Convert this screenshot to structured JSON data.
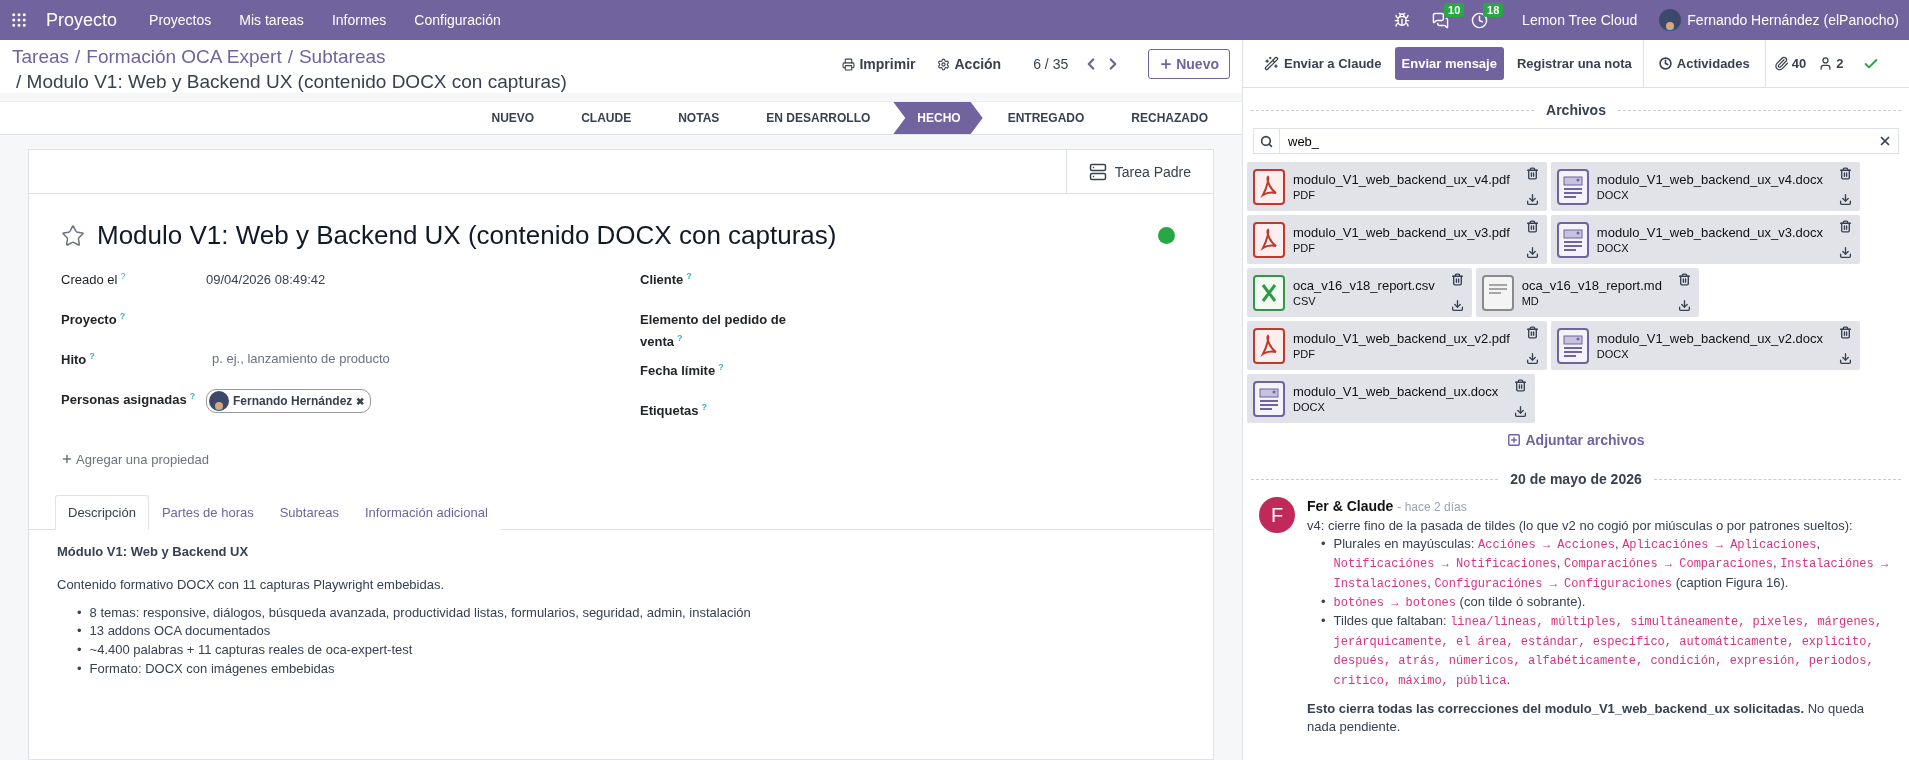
{
  "navbar": {
    "app": "Proyecto",
    "menus": [
      "Proyectos",
      "Mis tareas",
      "Informes",
      "Configuración"
    ],
    "messages_count": "10",
    "activities_count": "18",
    "company": "Lemon Tree Cloud",
    "user": "Fernando Hernández (elPanocho)"
  },
  "breadcrumb": {
    "separator": "/",
    "parents": [
      "Tareas",
      "Formación OCA Expert",
      "Subtareas"
    ],
    "current": "/ Modulo V1: Web y Backend UX (contenido DOCX con capturas)"
  },
  "actions": {
    "print": "Imprimir",
    "action": "Acción",
    "pager": "6 / 35",
    "new": "Nuevo"
  },
  "stages": [
    {
      "label": "NUEVO",
      "selected": false
    },
    {
      "label": "CLAUDE",
      "selected": false
    },
    {
      "label": "NOTAS",
      "selected": false
    },
    {
      "label": "EN DESARROLLO",
      "selected": false
    },
    {
      "label": "HECHO",
      "selected": true
    },
    {
      "label": "ENTREGADO",
      "selected": false
    },
    {
      "label": "RECHAZADO",
      "selected": false
    }
  ],
  "form": {
    "parent_button": "Tarea Padre",
    "starred": false,
    "title": "Modulo V1: Web y Backend UX (contenido DOCX con capturas)",
    "status_done": true,
    "left_fields": [
      {
        "label": "Creado el",
        "help": "?",
        "kind": "value",
        "value": "09/04/2026 08:49:42"
      },
      {
        "label": "Proyecto",
        "help": "?"
      },
      {
        "label": "Hito",
        "help": "?",
        "kind": "placeholder",
        "placeholder": "p. ej., lanzamiento de producto"
      },
      {
        "label": "Personas asignadas",
        "help": "?",
        "kind": "tag",
        "value": "Fernando Hernández",
        "remove": "✖"
      }
    ],
    "right_fields": [
      {
        "label": "Cliente",
        "help": "?"
      },
      {
        "label": "Elemento del pedido de venta",
        "help": "?"
      },
      {
        "label": "Fecha límite",
        "help": "?"
      },
      {
        "label": "Etiquetas",
        "help": "?"
      }
    ],
    "add_property": "Agregar una propiedad",
    "tabs": [
      {
        "label": "Descripción",
        "selected": true
      },
      {
        "label": "Partes de horas",
        "selected": false
      },
      {
        "label": "Subtareas",
        "selected": false
      },
      {
        "label": "Información adicional",
        "selected": false
      }
    ],
    "description": {
      "heading": "Módulo V1: Web y Backend UX",
      "paragraph": "Contenido formativo DOCX con 11 capturas Playwright embebidas.",
      "marker": "•",
      "bullets": [
        "8 temas: responsive, diálogos, búsqueda avanzada, productividad listas, formularios, seguridad, admin, instalación",
        "13 addons OCA documentados",
        "~4.400 palabras + 11 capturas reales de oca-expert-test",
        "Formato: DOCX con imágenes embebidas"
      ]
    }
  },
  "chatter": {
    "toolbar": {
      "send_claude": "Enviar a Claude",
      "send_message": "Enviar mensaje",
      "log_note": "Registrar una nota",
      "activities": "Actividades",
      "attachments_count": "40",
      "followers_count": "2"
    },
    "attachments_title": "Archivos",
    "search": "web_",
    "attachments": [
      {
        "name": "modulo_V1_web_backend_ux_v4.pdf",
        "type": "PDF",
        "kind": "pdf"
      },
      {
        "name": "modulo_V1_web_backend_ux_v4.docx",
        "type": "DOCX",
        "kind": "docx"
      },
      {
        "name": "modulo_V1_web_backend_ux_v3.pdf",
        "type": "PDF",
        "kind": "pdf"
      },
      {
        "name": "modulo_V1_web_backend_ux_v3.docx",
        "type": "DOCX",
        "kind": "docx"
      },
      {
        "name": "oca_v16_v18_report.csv",
        "type": "CSV",
        "kind": "csv"
      },
      {
        "name": "oca_v16_v18_report.md",
        "type": "MD",
        "kind": "md"
      },
      {
        "name": "modulo_V1_web_backend_ux_v2.pdf",
        "type": "PDF",
        "kind": "pdf"
      },
      {
        "name": "modulo_V1_web_backend_ux_v2.docx",
        "type": "DOCX",
        "kind": "docx"
      },
      {
        "name": "modulo_V1_web_backend_ux.docx",
        "type": "DOCX",
        "kind": "docx"
      }
    ],
    "add_files": "Adjuntar archivos",
    "date": "20 de mayo de 2026",
    "message": {
      "avatar_initial": "F",
      "author": "Fer & Claude",
      "time": "- hace 2 días",
      "intro": "v4: cierre fino de la pasada de tildes (lo que v2 no cogió por miúsculas o por patrones sueltos):",
      "marker": "•",
      "bullets": [
        {
          "segments": [
            {
              "kind": "text",
              "text": "Plurales en mayúsculas: "
            },
            {
              "kind": "code",
              "text": "Acciónes → Acciones"
            },
            {
              "kind": "text",
              "text": ", "
            },
            {
              "kind": "code",
              "text": "Aplicaciónes → Aplicaciones"
            },
            {
              "kind": "text",
              "text": ", "
            },
            {
              "kind": "code",
              "text": "Notificaciónes → Notificaciones"
            },
            {
              "kind": "text",
              "text": ", "
            },
            {
              "kind": "code",
              "text": "Comparaciónes → Comparaciones"
            },
            {
              "kind": "text",
              "text": ", "
            },
            {
              "kind": "code",
              "text": "Instalaciónes → Instalaciones"
            },
            {
              "kind": "text",
              "text": ", "
            },
            {
              "kind": "code",
              "text": "Configuraciónes → Configuraciones"
            },
            {
              "kind": "text",
              "text": " (caption Figura 16)."
            }
          ]
        },
        {
          "segments": [
            {
              "kind": "code",
              "text": "botónes → botones"
            },
            {
              "kind": "text",
              "text": " (con tilde ó sobrante)."
            }
          ]
        },
        {
          "segments": [
            {
              "kind": "text",
              "text": "Tildes que faltaban: "
            },
            {
              "kind": "code",
              "text": "linea/lineas, múltiples, simultáneamente, pixeles, márgenes, jerárquicamente, el área, estándar, especifico, automáticamente, explicito, después, atrás, númericos, alfabéticamente, condición, expresión, periodos, critico, máximo, pública"
            },
            {
              "kind": "text",
              "text": "."
            }
          ]
        }
      ],
      "closing": "**Esto cierra todas las correcciones del modulo_V1_web_backend_ux solicitadas.** No queda nada pendiente."
    }
  }
}
